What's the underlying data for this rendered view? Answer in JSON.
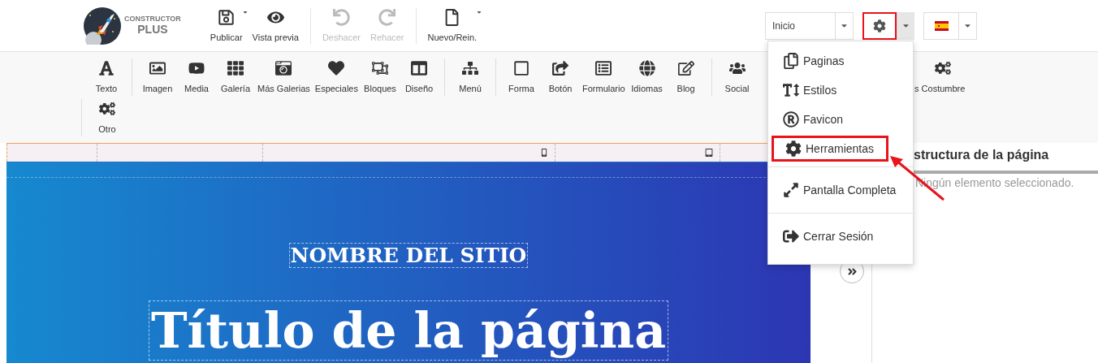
{
  "logo": {
    "line1": "CONSTRUCTOR",
    "line2": "PLUS"
  },
  "top_groups": [
    [
      {
        "label": "Publicar",
        "disabled": false,
        "dropdown": true
      },
      {
        "label": "Vista previa",
        "disabled": false,
        "dropdown": false
      }
    ],
    [
      {
        "label": "Deshacer",
        "disabled": true,
        "dropdown": false
      },
      {
        "label": "Rehacer",
        "disabled": true,
        "dropdown": false
      }
    ],
    [
      {
        "label": "Nuevo/Rein.",
        "disabled": false,
        "dropdown": true
      }
    ]
  ],
  "page_select": {
    "value": "Inicio"
  },
  "settings_button": {
    "highlighted": true,
    "expanded": true
  },
  "toolbar_groups": [
    [
      {
        "label": "Texto",
        "kind": "tool"
      }
    ],
    [
      {
        "label": "Imagen",
        "kind": "tool"
      },
      {
        "label": "Media",
        "kind": "tool"
      },
      {
        "label": "Galería",
        "kind": "tool"
      },
      {
        "label": "Más Galerias",
        "kind": "tool"
      },
      {
        "label": "Especiales",
        "kind": "tool"
      },
      {
        "label": "Bloques",
        "kind": "tool"
      },
      {
        "label": "Diseño",
        "kind": "tool"
      }
    ],
    [
      {
        "label": "Menú",
        "kind": "tool"
      }
    ],
    [
      {
        "label": "Forma",
        "kind": "tool"
      },
      {
        "label": "Botón",
        "kind": "tool"
      },
      {
        "label": "Formulario",
        "kind": "tool"
      },
      {
        "label": "Idiomas",
        "kind": "tool"
      },
      {
        "label": "Blog",
        "kind": "tool"
      }
    ],
    [
      {
        "label": "Social",
        "kind": "tool"
      },
      {
        "label": "s",
        "kind": "partial"
      },
      {
        "label": "Costumbre",
        "kind": "tool"
      }
    ],
    [
      {
        "label": "Otro",
        "kind": "tool"
      }
    ]
  ],
  "settings_menu": [
    [
      {
        "label": "Paginas",
        "highlighted": false
      },
      {
        "label": "Estilos",
        "highlighted": false
      },
      {
        "label": "Favicon",
        "highlighted": false
      },
      {
        "label": "Herramientas",
        "highlighted": true
      }
    ],
    [
      {
        "label": "Pantalla Completa",
        "highlighted": false
      }
    ],
    [
      {
        "label": "Cerrar Sesión",
        "highlighted": false
      }
    ]
  ],
  "canvas": {
    "site_name": "NOMBRE DEL SITIO",
    "page_title": "Título de la página"
  },
  "panel": {
    "title": "structura de la página",
    "empty_message": "Ningún elemento seleccionado."
  }
}
